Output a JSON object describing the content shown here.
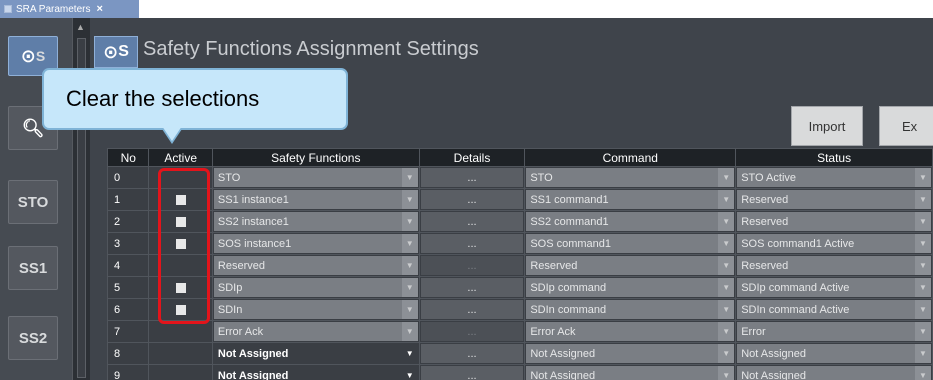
{
  "tab": {
    "label": "SRA Parameters",
    "close": "×"
  },
  "sidebar": {
    "items": [
      {
        "label": "S",
        "active": true
      },
      {
        "label": ""
      },
      {
        "label": "STO"
      },
      {
        "label": "SS1"
      },
      {
        "label": "SS2"
      }
    ]
  },
  "header": {
    "icon_label": "S",
    "title": "Safety Functions Assignment Settings"
  },
  "toolbar": {
    "import_label": "Import",
    "export_label": "Ex"
  },
  "callout": {
    "text": "Clear the selections"
  },
  "table": {
    "columns": [
      "No",
      "Active",
      "Safety Functions",
      "Details",
      "Command",
      "Status"
    ],
    "rows": [
      {
        "no": "0",
        "active": false,
        "func": "STO",
        "details": "...",
        "command": "STO",
        "status": "STO Active"
      },
      {
        "no": "1",
        "active": true,
        "func": "SS1 instance1",
        "details": "...",
        "command": "SS1 command1",
        "status": "Reserved"
      },
      {
        "no": "2",
        "active": true,
        "func": "SS2 instance1",
        "details": "...",
        "command": "SS2 command1",
        "status": "Reserved"
      },
      {
        "no": "3",
        "active": true,
        "func": "SOS instance1",
        "details": "...",
        "command": "SOS command1",
        "status": "SOS command1 Active"
      },
      {
        "no": "4",
        "active": false,
        "func": "Reserved",
        "details": "...",
        "command": "Reserved",
        "status": "Reserved"
      },
      {
        "no": "5",
        "active": true,
        "func": "SDIp",
        "details": "...",
        "command": "SDIp command",
        "status": "SDIp command Active"
      },
      {
        "no": "6",
        "active": true,
        "func": "SDIn",
        "details": "...",
        "command": "SDIn command",
        "status": "SDIn command Active"
      },
      {
        "no": "7",
        "active": false,
        "func": "Error Ack",
        "details": "...",
        "command": "Error Ack",
        "status": "Error"
      },
      {
        "no": "8",
        "active": false,
        "func": "Not Assigned",
        "details": "...",
        "command": "Not Assigned",
        "status": "Not Assigned"
      },
      {
        "no": "9",
        "active": false,
        "func": "Not Assigned",
        "details": "...",
        "command": "Not Assigned",
        "status": "Not Assigned"
      }
    ]
  }
}
